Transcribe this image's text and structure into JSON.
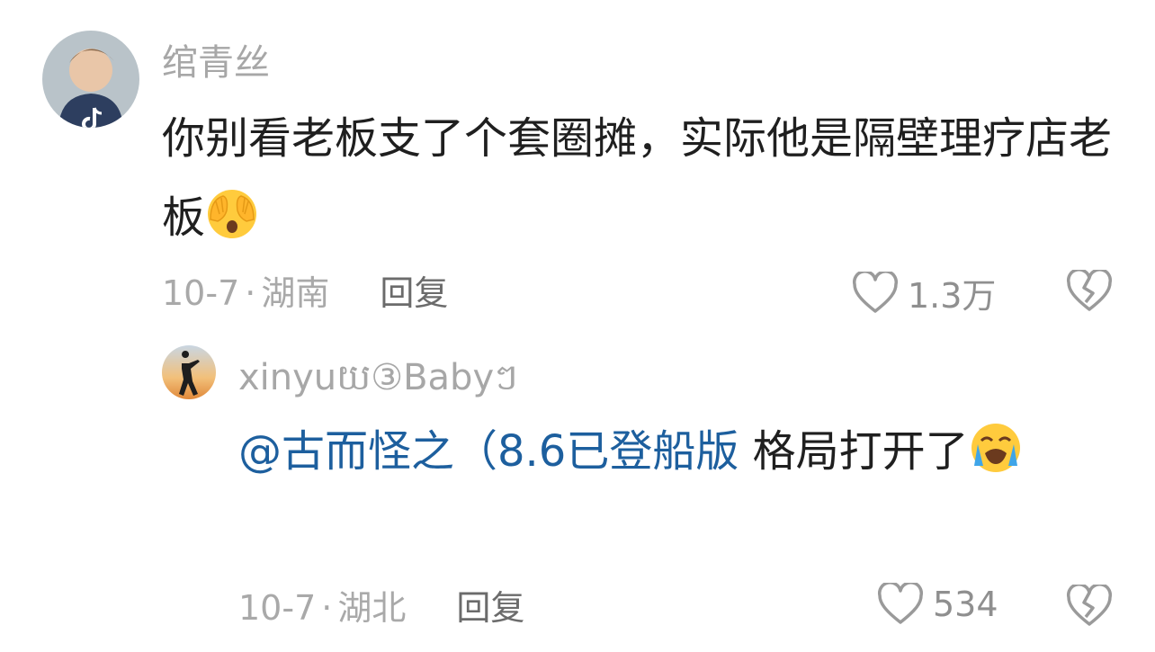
{
  "comments": [
    {
      "username": "绾青丝",
      "text": "你别看老板支了个套圈摊，实际他是隔壁理疗店老板",
      "emoji": "face-hands-over-eyes-emoji",
      "date": "10-7",
      "separator": "·",
      "location": "湖南",
      "reply_label": "回复",
      "likes": "1.3万"
    },
    {
      "username": "xinyuយ③Babyៗ",
      "mention": "@古而怪之（8.6已登船版",
      "text": "格局打开了",
      "emoji": "crying-face-emoji",
      "date": "10-7",
      "separator": "·",
      "location": "湖北",
      "reply_label": "回复",
      "likes": "534"
    }
  ],
  "colors": {
    "username": "#a7a7a7",
    "content": "#1f1f1f",
    "mention": "#1d5f9e",
    "meta": "#a9a9a9",
    "reply": "#6b6b6b"
  },
  "icons": [
    "heart-icon",
    "broken-heart-icon",
    "tiktok-logo-icon"
  ]
}
